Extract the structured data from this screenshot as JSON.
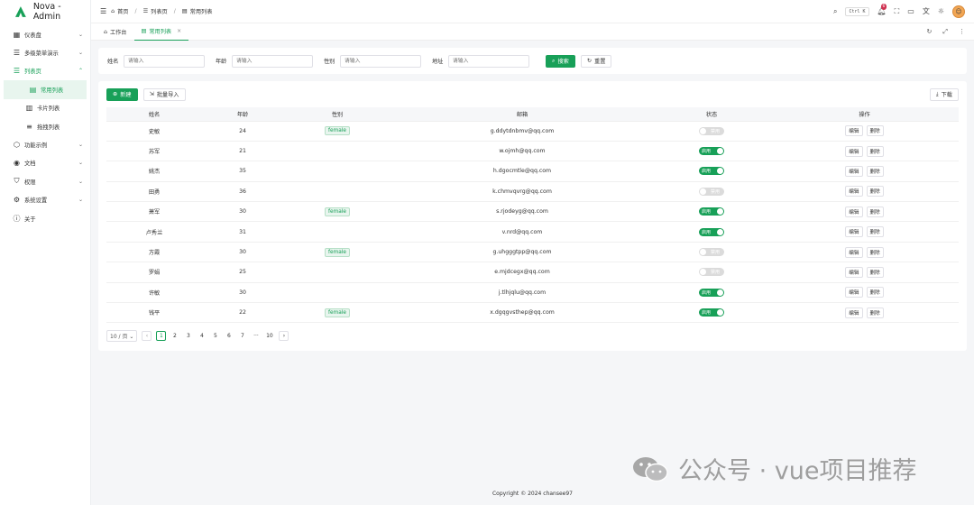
{
  "app": {
    "title": "Nova - Admin",
    "brand_color": "#18a058"
  },
  "sidebar": {
    "items": [
      {
        "label": "仪表盘",
        "icon": "dashboard-icon",
        "arrow": "﹀"
      },
      {
        "label": "多级菜单演示",
        "icon": "menu-list-icon",
        "arrow": "﹀"
      },
      {
        "label": "列表页",
        "icon": "list-icon",
        "arrow": "︿"
      },
      {
        "label": "常用列表",
        "icon": "table-icon"
      },
      {
        "label": "卡片列表",
        "icon": "card-icon"
      },
      {
        "label": "拖拽列表",
        "icon": "drag-list-icon"
      },
      {
        "label": "功能示例",
        "icon": "function-icon",
        "arrow": "﹀"
      },
      {
        "label": "文档",
        "icon": "docs-icon",
        "arrow": "﹀"
      },
      {
        "label": "权限",
        "icon": "shield-icon",
        "arrow": "﹀"
      },
      {
        "label": "系统设置",
        "icon": "settings-icon",
        "arrow": "﹀"
      },
      {
        "label": "关于",
        "icon": "info-icon"
      }
    ]
  },
  "header": {
    "breadcrumbs": [
      "首页",
      "列表页",
      "常用列表"
    ],
    "search_shortcut": "Ctrl K",
    "notification_count": "6"
  },
  "tabs": [
    {
      "label": "工作台"
    },
    {
      "label": "常用列表",
      "close": "×"
    }
  ],
  "search_form": {
    "fields": [
      {
        "label": "姓名",
        "placeholder": "请输入"
      },
      {
        "label": "年龄",
        "placeholder": "请输入"
      },
      {
        "label": "性别",
        "placeholder": "请输入"
      },
      {
        "label": "地址",
        "placeholder": "请输入"
      }
    ],
    "search_label": "搜索",
    "reset_label": "重置"
  },
  "table": {
    "add_label": "新建",
    "import_label": "批量导入",
    "download_label": "下载",
    "columns": [
      "姓名",
      "年龄",
      "性别",
      "邮箱",
      "状态",
      "操作"
    ],
    "enabled_label": "启用",
    "disabled_label": "禁用",
    "edit_label": "编辑",
    "delete_label": "删除",
    "rows": [
      {
        "name": "史敏",
        "age": "24",
        "gender": "female",
        "email": "g.ddytdnbmv@qq.com",
        "enabled": false
      },
      {
        "name": "苏军",
        "age": "21",
        "gender": "",
        "email": "w.ojmh@qq.com",
        "enabled": true
      },
      {
        "name": "姚杰",
        "age": "35",
        "gender": "",
        "email": "h.dgocmtle@qq.com",
        "enabled": true
      },
      {
        "name": "田勇",
        "age": "36",
        "gender": "",
        "email": "k.chmvqvrg@qq.com",
        "enabled": false
      },
      {
        "name": "萧军",
        "age": "30",
        "gender": "female",
        "email": "s.rjodeyg@qq.com",
        "enabled": true
      },
      {
        "name": "卢秀兰",
        "age": "31",
        "gender": "",
        "email": "v.nrd@qq.com",
        "enabled": true
      },
      {
        "name": "方霞",
        "age": "30",
        "gender": "female",
        "email": "g.uhgggtpp@qq.com",
        "enabled": false
      },
      {
        "name": "罗娟",
        "age": "25",
        "gender": "",
        "email": "e.mjdcegx@qq.com",
        "enabled": false
      },
      {
        "name": "许敏",
        "age": "30",
        "gender": "",
        "email": "j.tlhjqlu@qq.com",
        "enabled": true
      },
      {
        "name": "钱平",
        "age": "22",
        "gender": "female",
        "email": "x.dgqgvsthep@qq.com",
        "enabled": true
      }
    ]
  },
  "pagination": {
    "page_size": "10 / 页",
    "pages": [
      "1",
      "2",
      "3",
      "4",
      "5",
      "6",
      "7",
      "···",
      "10"
    ],
    "current": "1"
  },
  "footer": {
    "copyright": "Copyright © 2024 chansee97"
  },
  "watermark": {
    "text": "公众号 · vue项目推荐"
  }
}
